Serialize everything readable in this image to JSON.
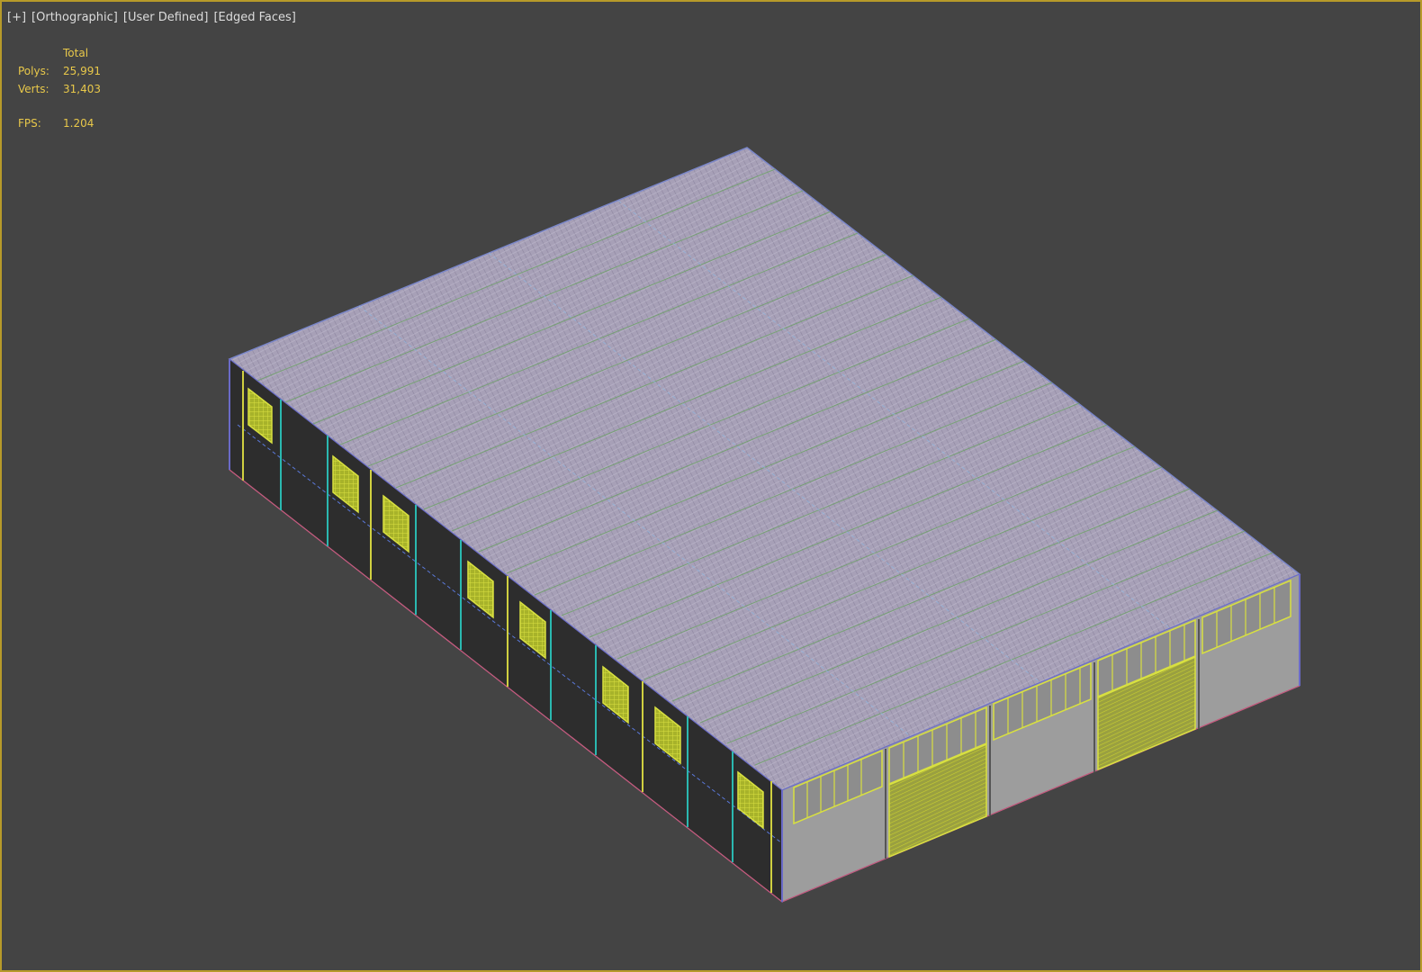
{
  "viewport": {
    "labels": {
      "plus": "[+]",
      "projection": "[Orthographic]",
      "shading": "[User Defined]",
      "edges": "[Edged Faces]"
    }
  },
  "stats": {
    "header": "Total",
    "polys_label": "Polys:",
    "polys_value": "25,991",
    "verts_label": "Verts:",
    "verts_value": "31,403",
    "fps_label": "FPS:",
    "fps_value": "1.204"
  },
  "colors": {
    "viewport_bg": "#444444",
    "active_border": "#b79a2a",
    "stats_text": "#e8c84a",
    "roof": "#a49cb4",
    "wall_dark": "#2d2d2d",
    "wall_light": "#9d9d9d",
    "window_yellow": "#b8c82a"
  }
}
